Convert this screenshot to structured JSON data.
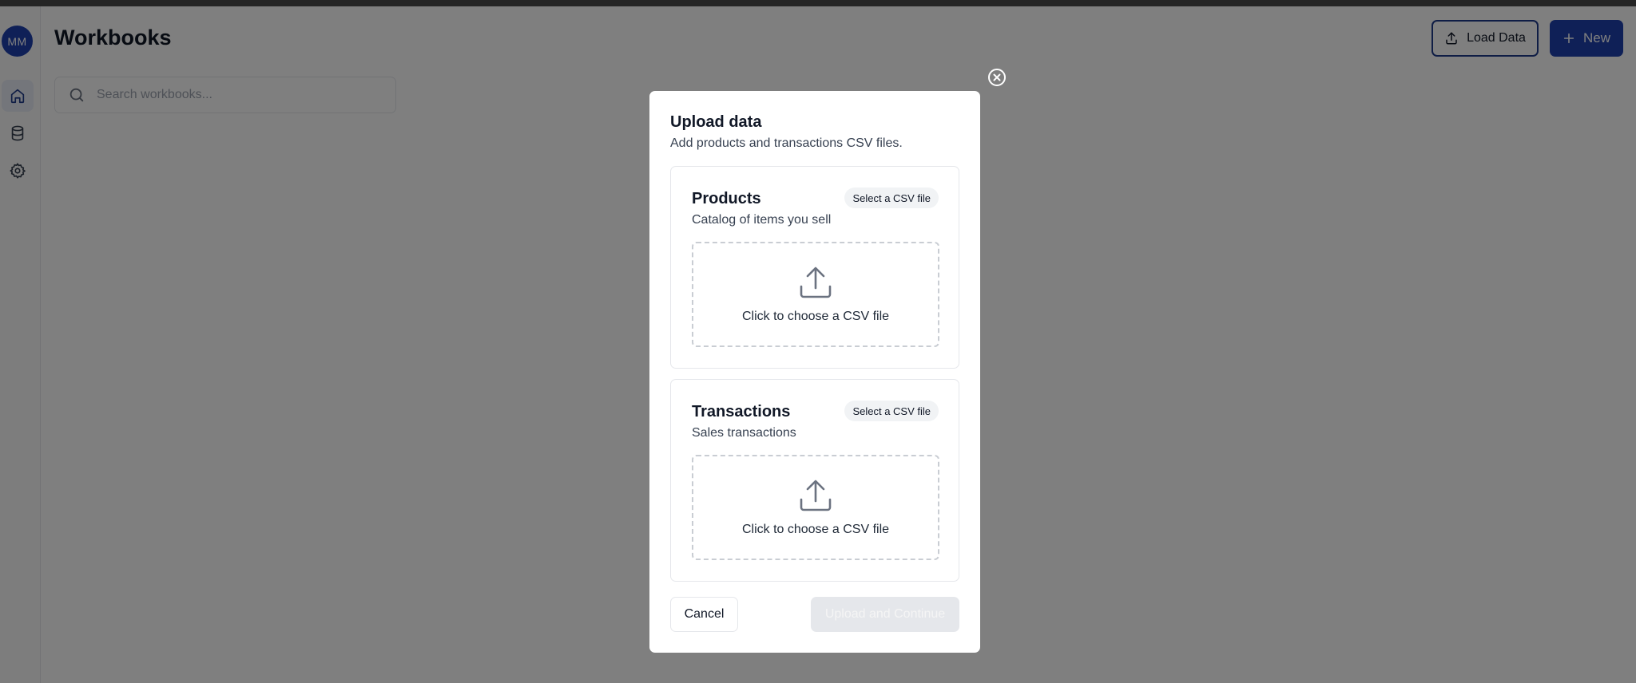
{
  "sidebar": {
    "avatar_initials": "MM",
    "items": [
      {
        "icon": "home-icon",
        "active": true
      },
      {
        "icon": "database-icon",
        "active": false
      },
      {
        "icon": "gear-icon",
        "active": false
      }
    ]
  },
  "header": {
    "title": "Workbooks",
    "load_data_label": "Load Data",
    "new_label": "New"
  },
  "search": {
    "placeholder": "Search workbooks..."
  },
  "modal": {
    "title": "Upload data",
    "subtitle": "Add products and transactions CSV files.",
    "cards": [
      {
        "title": "Products",
        "description": "Catalog of items you sell",
        "badge": "Select a CSV file",
        "dropzone_text": "Click to choose a CSV file"
      },
      {
        "title": "Transactions",
        "description": "Sales transactions",
        "badge": "Select a CSV file",
        "dropzone_text": "Click to choose a CSV file"
      }
    ],
    "cancel_label": "Cancel",
    "submit_label": "Upload and Continue",
    "submit_disabled": true
  },
  "colors": {
    "accent": "#1e40af",
    "overlay": "rgba(0,0,0,0.5)"
  }
}
